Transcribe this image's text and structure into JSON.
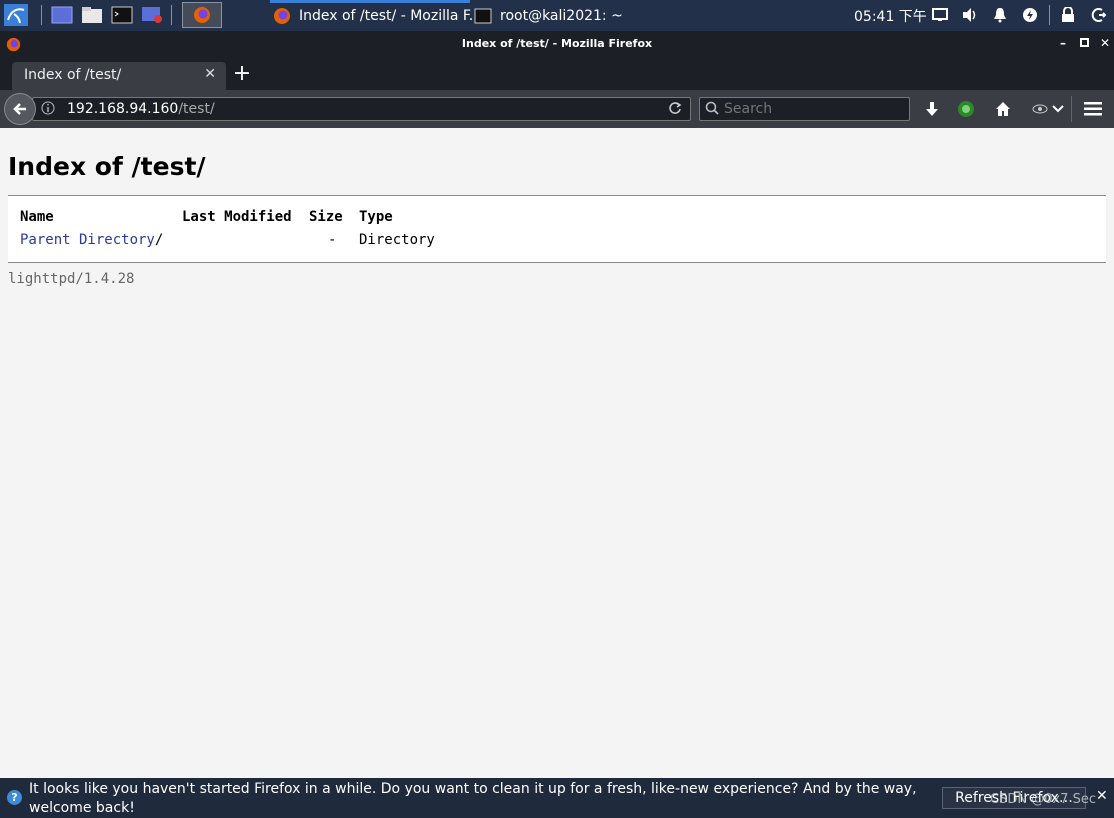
{
  "taskbar": {
    "tasks": [
      {
        "label": "Index of /test/ - Mozilla F..."
      },
      {
        "label": "root@kali2021: ~"
      }
    ],
    "clock": "05:41 下午"
  },
  "window": {
    "title": "Index of /test/ - Mozilla Firefox"
  },
  "tabs": [
    {
      "label": "Index of /test/"
    }
  ],
  "urlbar": {
    "host": "192.168.94.160",
    "path": "/test/"
  },
  "search": {
    "placeholder": "Search"
  },
  "page": {
    "heading": "Index of /test/",
    "columns": {
      "name": "Name",
      "modified": "Last Modified",
      "size": "Size",
      "type": "Type"
    },
    "rows": [
      {
        "name": "Parent Directory",
        "suffix": "/",
        "modified": "",
        "size": "-",
        "type": "Directory"
      }
    ],
    "server": "lighttpd/1.4.28"
  },
  "notification": {
    "message": "It looks like you haven't started Firefox in a while. Do you want to clean it up for a fresh, like-new experience? And by the way, welcome back!",
    "button": "Refresh Firefox…",
    "watermark": "CSDN @0x7 Sec"
  },
  "colors": {
    "taskbar": "#22304a",
    "page_background": "#f4f4f4",
    "link": "#2a3a9a",
    "notification": "#1f2a3d"
  }
}
